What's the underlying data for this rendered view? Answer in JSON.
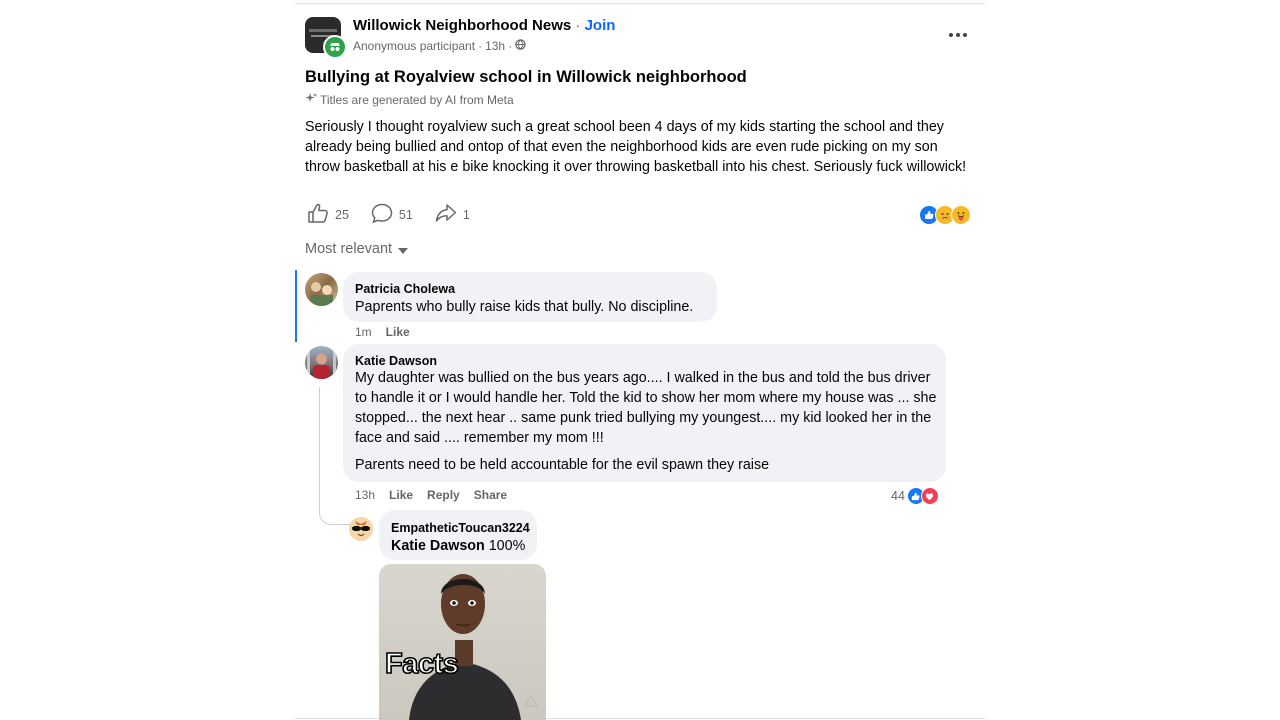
{
  "post": {
    "group_name": "Willowick Neighborhood News",
    "separator": "·",
    "join_label": "Join",
    "author": "Anonymous participant",
    "time": "13h",
    "title": "Bullying at Royalview school in Willowick neighborhood",
    "ai_note": "Titles are generated by AI from Meta",
    "body": "Seriously I thought royalview such a great school been 4 days of my kids starting the school and they already being bullied and ontop of that even the neighborhood kids are even rude picking on my son throw basketball at his e bike knocking it over throwing basketball into his chest. Seriously fuck willowick!",
    "like_count": "25",
    "comment_count": "51",
    "share_count": "1",
    "reactions": [
      "like-icon",
      "sad-icon",
      "care-icon"
    ]
  },
  "sort": {
    "label": "Most relevant"
  },
  "comments": [
    {
      "name": "Patricia Cholewa",
      "text": "Paprents who bully raise kids that bully. No discipline.",
      "time": "1m",
      "like": "Like"
    },
    {
      "name": "Katie Dawson",
      "text": "My daughter was bullied on the bus years ago.... I walked in the bus and told the bus driver to handle it or I would handle her. Told the kid to show her mom where my house was ... she stopped... the next hear .. same punk tried bullying my youngest.... my kid looked her in the face and said .... remember my mom !!!",
      "text2": "Parents need to be held accountable for the evil spawn they raise",
      "time": "13h",
      "like": "Like",
      "reply": "Reply",
      "share": "Share",
      "reaction_count": "44",
      "reactions": [
        "like-icon",
        "love-icon"
      ]
    }
  ],
  "reply": {
    "name": "EmpatheticToucan3224",
    "mention": "Katie Dawson",
    "text": "100%",
    "meme_caption": "Facts"
  },
  "colors": {
    "link": "#0866ff",
    "like": "#1877f2",
    "love": "#f33e58",
    "bubble": "#f0f2f5",
    "muted": "#65676b"
  }
}
